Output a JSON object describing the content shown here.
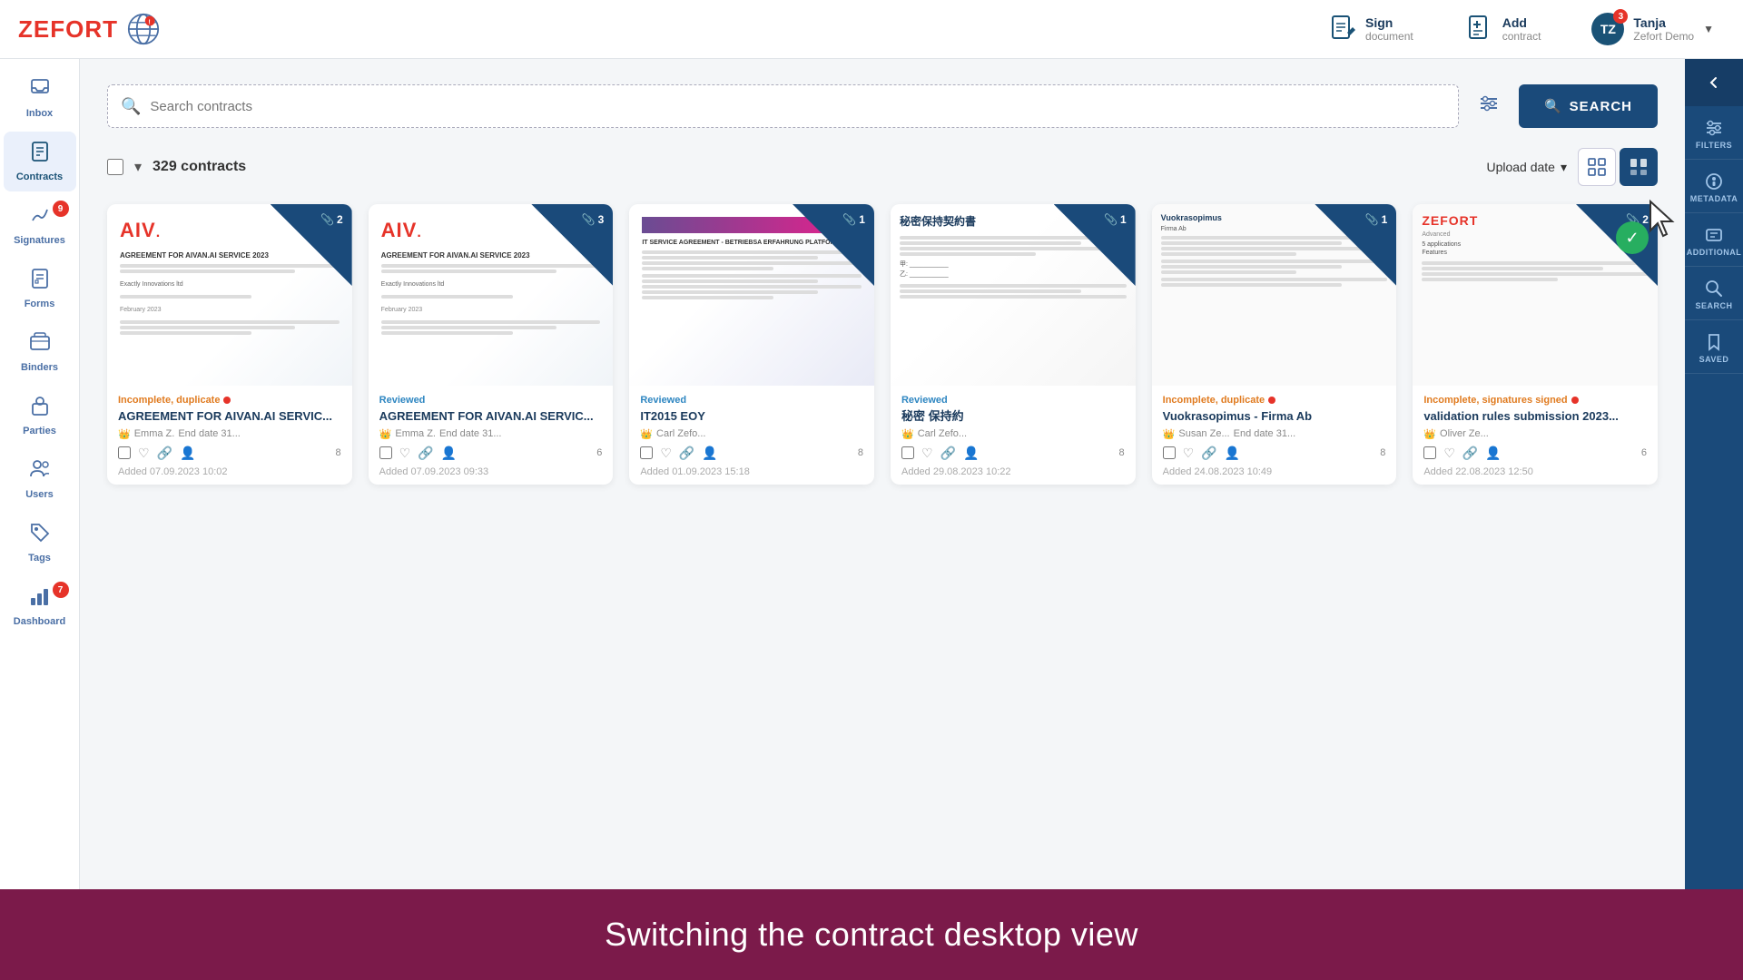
{
  "app": {
    "title": "ZEFORT",
    "notification_count": "3"
  },
  "header": {
    "sign_doc_label": "Sign",
    "sign_doc_sublabel": "document",
    "add_contract_label": "Add",
    "add_contract_sublabel": "contract",
    "user_name": "Tanja",
    "user_company": "Zefort Demo",
    "notification_count": "3"
  },
  "sidebar": {
    "items": [
      {
        "id": "inbox",
        "label": "Inbox",
        "icon": "📥",
        "badge": null
      },
      {
        "id": "contracts",
        "label": "Contracts",
        "icon": "📄",
        "badge": null,
        "active": true
      },
      {
        "id": "signatures",
        "label": "Signatures",
        "icon": "✍️",
        "badge": "9"
      },
      {
        "id": "forms",
        "label": "Forms",
        "icon": "📋",
        "badge": null
      },
      {
        "id": "binders",
        "label": "Binders",
        "icon": "📁",
        "badge": null
      },
      {
        "id": "parties",
        "label": "Parties",
        "icon": "🏢",
        "badge": null
      },
      {
        "id": "users",
        "label": "Users",
        "icon": "👥",
        "badge": null
      },
      {
        "id": "tags",
        "label": "Tags",
        "icon": "🏷️",
        "badge": null
      },
      {
        "id": "dashboard",
        "label": "Dashboard",
        "icon": "📊",
        "badge": "7"
      }
    ]
  },
  "search": {
    "placeholder": "Search contracts",
    "search_button": "SEARCH"
  },
  "toolbar": {
    "contracts_count": "329 contracts",
    "sort_label": "Upload date",
    "grid_view_label": "Grid view",
    "list_view_label": "List view"
  },
  "contracts": [
    {
      "id": 1,
      "status": "Incomplete, duplicate",
      "status_type": "incomplete",
      "title": "AGREEMENT FOR AIVAN.AI SERVIC...",
      "assignee": "Emma Z.",
      "end_date": "End date 31...",
      "attachments": 2,
      "shared": 8,
      "added": "Added 07.09.2023 10:02",
      "preview_type": "aivan"
    },
    {
      "id": 2,
      "status": "Reviewed",
      "status_type": "reviewed",
      "title": "AGREEMENT FOR AIVAN.AI SERVIC...",
      "assignee": "Emma Z.",
      "end_date": "End date 31...",
      "attachments": 3,
      "shared": 6,
      "added": "Added 07.09.2023 09:33",
      "preview_type": "aivan"
    },
    {
      "id": 3,
      "status": "Reviewed",
      "status_type": "reviewed",
      "title": "IT2015 EOY",
      "assignee": "Carl Zefo...",
      "end_date": "",
      "attachments": 1,
      "shared": 8,
      "added": "Added 01.09.2023 15:18",
      "preview_type": "it2015"
    },
    {
      "id": 4,
      "status": "Reviewed",
      "status_type": "reviewed",
      "title": "秘密 保持約",
      "assignee": "Carl Zefo...",
      "end_date": "",
      "attachments": 1,
      "shared": 8,
      "added": "Added 29.08.2023 10:22",
      "preview_type": "japanese"
    },
    {
      "id": 5,
      "status": "Incomplete, duplicate",
      "status_type": "incomplete",
      "title": "Vuokrasopimus - Firma Ab",
      "assignee": "Susan Ze...",
      "end_date": "End date 31...",
      "attachments": 1,
      "shared": 8,
      "added": "Added 24.08.2023 10:49",
      "preview_type": "vuokra"
    },
    {
      "id": 6,
      "status": "Incomplete, signatures signed",
      "status_type": "incomplete",
      "title": "validation rules submission 2023...",
      "assignee": "Oliver Ze...",
      "end_date": "",
      "attachments": 2,
      "shared": 6,
      "added": "Added 22.08.2023 12:50",
      "preview_type": "validation",
      "has_green_badge": true
    }
  ],
  "right_panel": {
    "items": [
      {
        "id": "filters",
        "label": "FILTERS",
        "icon": "⚙️"
      },
      {
        "id": "metadata",
        "label": "METADATA",
        "icon": "🏷️"
      },
      {
        "id": "additional",
        "label": "ADDITIONAL",
        "icon": "📋"
      },
      {
        "id": "search",
        "label": "SEARCH",
        "icon": "🔍"
      },
      {
        "id": "saved",
        "label": "SAVED",
        "icon": "🔖"
      }
    ]
  },
  "banner": {
    "text": "Switching the contract desktop view"
  }
}
